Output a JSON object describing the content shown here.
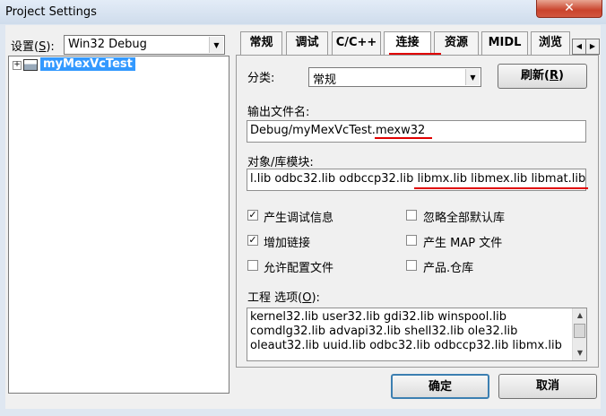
{
  "window": {
    "title": "Project Settings",
    "close_glyph": "✕"
  },
  "settings": {
    "label": "设置(S):",
    "value": "Win32 Debug"
  },
  "tree": {
    "expander": "+",
    "item": "myMexVcTest"
  },
  "tabs": [
    {
      "label": "常规",
      "active": false
    },
    {
      "label": "调试",
      "active": false
    },
    {
      "label": "C/C++",
      "active": false
    },
    {
      "label": "连接",
      "active": true
    },
    {
      "label": "资源",
      "active": false
    },
    {
      "label": "MIDL",
      "active": false
    },
    {
      "label": "浏览",
      "active": false
    }
  ],
  "tab_scroll": {
    "left": "◀",
    "right": "▶"
  },
  "category": {
    "label": "分类:",
    "value": "常规"
  },
  "reset_button": "刷新(R)",
  "output_file": {
    "label": "输出文件名:",
    "value": "Debug/myMexVcTest.mexw32"
  },
  "modules": {
    "label": "对象/库模块:",
    "value": "l.lib odbc32.lib odbccp32.lib libmx.lib libmex.lib libmat.lib"
  },
  "checkboxes": [
    {
      "label": "产生调试信息",
      "checked": true
    },
    {
      "label": "忽略全部默认库",
      "checked": false
    },
    {
      "label": "增加链接",
      "checked": true
    },
    {
      "label": "产生 MAP 文件",
      "checked": false
    },
    {
      "label": "允许配置文件",
      "checked": false
    },
    {
      "label": "产品.仓库",
      "checked": false
    }
  ],
  "project_options": {
    "label": "工程 选项(O):",
    "lines": [
      "kernel32.lib user32.lib gdi32.lib winspool.lib",
      "comdlg32.lib advapi32.lib shell32.lib ole32.lib",
      "oleaut32.lib uuid.lib odbc32.lib odbccp32.lib libmx.lib"
    ]
  },
  "buttons": {
    "ok": "确定",
    "cancel": "取消"
  },
  "colors": {
    "accent_selection": "#3399ff",
    "annotation": "#e00000"
  }
}
